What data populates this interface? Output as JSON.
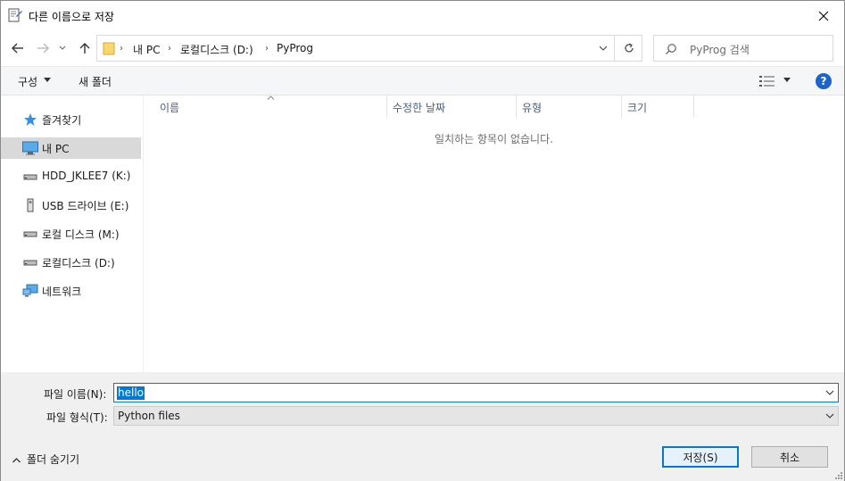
{
  "window": {
    "title": "다른 이름으로 저장"
  },
  "nav": {
    "breadcrumbs": [
      "내 PC",
      "로컬디스크 (D:)",
      "PyProg"
    ],
    "search_placeholder": "PyProg 검색"
  },
  "toolbar": {
    "organize_label": "구성",
    "new_folder_label": "새 폴더"
  },
  "sidebar": {
    "items": [
      {
        "label": "즐겨찾기",
        "icon": "star-icon"
      },
      {
        "label": "내 PC",
        "icon": "computer-icon",
        "selected": true
      },
      {
        "label": "HDD_JKLEE7 (K:)",
        "icon": "drive-icon"
      },
      {
        "label": "USB 드라이브 (E:)",
        "icon": "usb-drive-icon"
      },
      {
        "label": "로컬 디스크 (M:)",
        "icon": "drive-icon"
      },
      {
        "label": "로컬디스크 (D:)",
        "icon": "drive-icon"
      },
      {
        "label": "네트워크",
        "icon": "network-icon"
      }
    ]
  },
  "filelist": {
    "columns": [
      "이름",
      "수정한 날짜",
      "유형",
      "크기"
    ],
    "empty_message": "일치하는 항목이 없습니다."
  },
  "form": {
    "filename_label": "파일 이름(N):",
    "filename_value": "hello",
    "filetype_label": "파일 형식(T):",
    "filetype_value": "Python files"
  },
  "footer": {
    "hide_folders_label": "폴더 숨기기",
    "save_label": "저장(S)",
    "cancel_label": "취소"
  },
  "colors": {
    "accent": "#0078d7",
    "help": "#1c64c8",
    "selected_item": "#d9d9d9"
  }
}
